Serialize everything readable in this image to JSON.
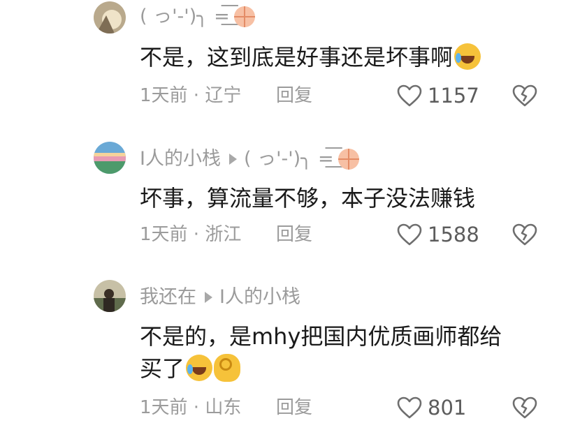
{
  "comments": [
    {
      "username": "( っ'-')╮ =͟͟͞͞",
      "reply_to": "",
      "text_lines": [
        "不是，这到底是好事还是坏事啊"
      ],
      "trailing_emoji": [
        "rolling-on-floor-laughing"
      ],
      "time": "1天前",
      "location": "辽宁",
      "reply_label": "回复",
      "likes": "1157"
    },
    {
      "username": "I人的小栈",
      "reply_to": "( っ'-')╮ =͟͟͞͞",
      "text_lines": [
        "坏事，算流量不够，本子没法赚钱"
      ],
      "trailing_emoji": [],
      "time": "1天前",
      "location": "浙江",
      "reply_label": "回复",
      "likes": "1588"
    },
    {
      "username": "我还在",
      "reply_to": "I人的小栈",
      "text_lines": [
        "不是的，是mhy把国内优质画师都给",
        "买了"
      ],
      "trailing_emoji": [
        "rolling-on-floor-laughing",
        "ok-hand"
      ],
      "time": "1天前",
      "location": "山东",
      "reply_label": "回复",
      "likes": "801"
    }
  ],
  "separator": " · ",
  "icons": {
    "like": "heart-outline-icon",
    "dislike": "broken-heart-icon",
    "reply_arrow": "play-triangle-icon",
    "basketball": "basketball-emoji"
  },
  "colors": {
    "text": "#1a1a1a",
    "muted": "#9b9b9b",
    "like_count": "#5c5c5c"
  }
}
